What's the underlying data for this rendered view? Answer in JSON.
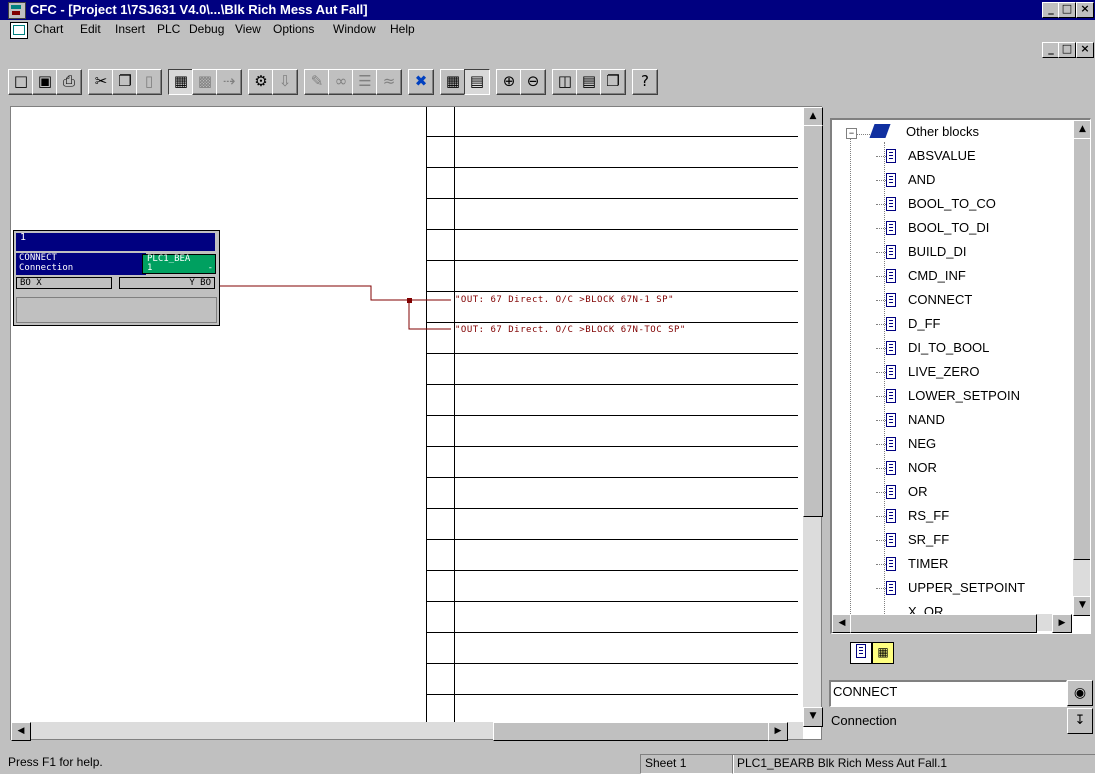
{
  "window": {
    "title": "CFC - [Project 1\\7SJ631 V4.0\\...\\Blk Rich Mess Aut Fall]",
    "controls": [
      "_",
      "□",
      "×"
    ]
  },
  "menu": {
    "items": [
      "Chart",
      "Edit",
      "Insert",
      "PLC",
      "Debug",
      "View",
      "Options",
      "Window",
      "Help"
    ]
  },
  "toolbar": {
    "icons": [
      "new-icon",
      "open-icon",
      "print-icon",
      "cut-icon",
      "copy-icon",
      "paste-icon",
      "chart-icon",
      "object-icon",
      "jump-icon",
      "compile-icon",
      "download-icon",
      "test-icon",
      "watch-icon",
      "monitor-icon",
      "trend-icon",
      "overview-icon",
      "grid-icon",
      "catalog-icon",
      "zoom-in-icon",
      "zoom-out-icon",
      "split-vertical-icon",
      "split-horizontal-icon",
      "window-icon",
      "help-context-icon"
    ]
  },
  "block": {
    "number": "1",
    "type": "CONNECT",
    "comment": "Connection",
    "instance_line1": "PLC1_BEA",
    "instance_line2": "1",
    "instance_suffix": "-",
    "input_pin": "BO X",
    "output_pin": "Y BO"
  },
  "signals": [
    "\"OUT: 67 Direct. O/C >BLOCK 67N-1 SP\"",
    "\"OUT: 67 Direct. O/C >BLOCK 67N-TOC SP\""
  ],
  "catalog": {
    "root": "Other blocks",
    "items": [
      "ABSVALUE",
      "AND",
      "BOOL_TO_CO",
      "BOOL_TO_DI",
      "BUILD_DI",
      "CMD_INF",
      "CONNECT",
      "D_FF",
      "DI_TO_BOOL",
      "LIVE_ZERO",
      "LOWER_SETPOIN",
      "NAND",
      "NEG",
      "NOR",
      "OR",
      "RS_FF",
      "SR_FF",
      "TIMER",
      "UPPER_SETPOINT",
      "X_OR"
    ],
    "selected_name": "CONNECT",
    "selected_comment": "Connection"
  },
  "status": {
    "help": "Press F1 for help.",
    "sheet": "Sheet 1",
    "path": "PLC1_BEARB  Blk Rich Mess Aut Fall.1"
  },
  "colors": {
    "titlebar": "#000080",
    "block_header": "#000080",
    "instance_fill": "#00a060",
    "connection_line": "#800000"
  }
}
